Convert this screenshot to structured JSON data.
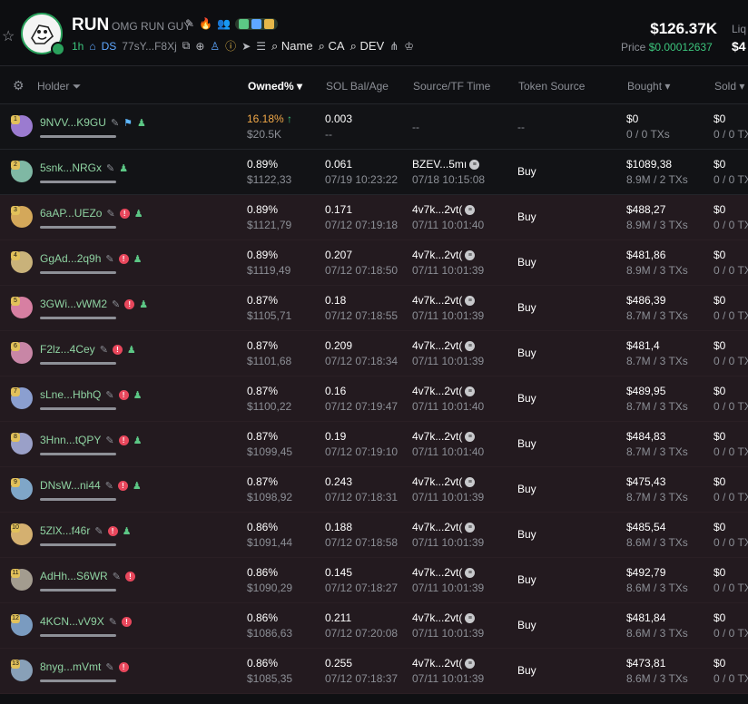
{
  "token": {
    "ticker": "RUN",
    "name": "OMG RUN GUY",
    "age": "1h",
    "ds_label": "DS",
    "ca_short": "77sY...F8Xj",
    "search_links": [
      "Name",
      "CA",
      "DEV"
    ],
    "market_cap": "$126.37K",
    "price_label": "Price",
    "price": "$0.00012637",
    "liq_label": "Liq",
    "liq_value": "$4"
  },
  "columns": {
    "holder": "Holder",
    "owned": "Owned%",
    "sol_bal": "SOL Bal/Age",
    "source": "Source/TF Time",
    "token_source": "Token Source",
    "bought": "Bought",
    "sold": "Sold"
  },
  "rows": [
    {
      "rank": "1",
      "addr": "9NVV...K9GU",
      "pct": "16.18%",
      "usd": "$20.5K",
      "sol": "0.003",
      "age": "--",
      "src": "--",
      "src_time": "",
      "tsource": "--",
      "bought": "$0",
      "bought_tx": "0 / 0 TXs",
      "sold": "$0",
      "sold_tx": "0 / 0 TX"
    },
    {
      "rank": "2",
      "addr": "5snk...NRGx",
      "pct": "0.89%",
      "usd": "$1122,33",
      "sol": "0.061",
      "age": "07/19 10:23:22",
      "src": "BZEV...5mı",
      "src_time": "07/18 10:15:08",
      "tsource": "Buy",
      "bought": "$1089,38",
      "bought_tx": "8.9M / 2 TXs",
      "sold": "$0",
      "sold_tx": "0 / 0 TX"
    },
    {
      "rank": "3",
      "addr": "6aAP...UEZo",
      "pct": "0.89%",
      "usd": "$1121,79",
      "sol": "0.171",
      "age": "07/12 07:19:18",
      "src": "4v7k...2vt(",
      "src_time": "07/11 10:01:40",
      "tsource": "Buy",
      "bought": "$488,27",
      "bought_tx": "8.9M / 3 TXs",
      "sold": "$0",
      "sold_tx": "0 / 0 TX"
    },
    {
      "rank": "4",
      "addr": "GgAd...2q9h",
      "pct": "0.89%",
      "usd": "$1119,49",
      "sol": "0.207",
      "age": "07/12 07:18:50",
      "src": "4v7k...2vt(",
      "src_time": "07/11 10:01:39",
      "tsource": "Buy",
      "bought": "$481,86",
      "bought_tx": "8.9M / 3 TXs",
      "sold": "$0",
      "sold_tx": "0 / 0 TX"
    },
    {
      "rank": "5",
      "addr": "3GWi...vWM2",
      "pct": "0.87%",
      "usd": "$1105,71",
      "sol": "0.18",
      "age": "07/12 07:18:55",
      "src": "4v7k...2vt(",
      "src_time": "07/11 10:01:39",
      "tsource": "Buy",
      "bought": "$486,39",
      "bought_tx": "8.7M / 3 TXs",
      "sold": "$0",
      "sold_tx": "0 / 0 TX"
    },
    {
      "rank": "6",
      "addr": "F2lz...4Cey",
      "pct": "0.87%",
      "usd": "$1101,68",
      "sol": "0.209",
      "age": "07/12 07:18:34",
      "src": "4v7k...2vt(",
      "src_time": "07/11 10:01:39",
      "tsource": "Buy",
      "bought": "$481,4",
      "bought_tx": "8.7M / 3 TXs",
      "sold": "$0",
      "sold_tx": "0 / 0 TX"
    },
    {
      "rank": "7",
      "addr": "sLne...HbhQ",
      "pct": "0.87%",
      "usd": "$1100,22",
      "sol": "0.16",
      "age": "07/12 07:19:47",
      "src": "4v7k...2vt(",
      "src_time": "07/11 10:01:40",
      "tsource": "Buy",
      "bought": "$489,95",
      "bought_tx": "8.7M / 3 TXs",
      "sold": "$0",
      "sold_tx": "0 / 0 TX"
    },
    {
      "rank": "8",
      "addr": "3Hnn...tQPY",
      "pct": "0.87%",
      "usd": "$1099,45",
      "sol": "0.19",
      "age": "07/12 07:19:10",
      "src": "4v7k...2vt(",
      "src_time": "07/11 10:01:40",
      "tsource": "Buy",
      "bought": "$484,83",
      "bought_tx": "8.7M / 3 TXs",
      "sold": "$0",
      "sold_tx": "0 / 0 TX"
    },
    {
      "rank": "9",
      "addr": "DNsW...ni44",
      "pct": "0.87%",
      "usd": "$1098,92",
      "sol": "0.243",
      "age": "07/12 07:18:31",
      "src": "4v7k...2vt(",
      "src_time": "07/11 10:01:39",
      "tsource": "Buy",
      "bought": "$475,43",
      "bought_tx": "8.7M / 3 TXs",
      "sold": "$0",
      "sold_tx": "0 / 0 TX"
    },
    {
      "rank": "10",
      "addr": "5ZlX...f46r",
      "pct": "0.86%",
      "usd": "$1091,44",
      "sol": "0.188",
      "age": "07/12 07:18:58",
      "src": "4v7k...2vt(",
      "src_time": "07/11 10:01:39",
      "tsource": "Buy",
      "bought": "$485,54",
      "bought_tx": "8.6M / 3 TXs",
      "sold": "$0",
      "sold_tx": "0 / 0 TX"
    },
    {
      "rank": "11",
      "addr": "AdHh...S6WR",
      "pct": "0.86%",
      "usd": "$1090,29",
      "sol": "0.145",
      "age": "07/12 07:18:27",
      "src": "4v7k...2vt(",
      "src_time": "07/11 10:01:39",
      "tsource": "Buy",
      "bought": "$492,79",
      "bought_tx": "8.6M / 3 TXs",
      "sold": "$0",
      "sold_tx": "0 / 0 TX"
    },
    {
      "rank": "12",
      "addr": "4KCN...vV9X",
      "pct": "0.86%",
      "usd": "$1086,63",
      "sol": "0.211",
      "age": "07/12 07:20:08",
      "src": "4v7k...2vt(",
      "src_time": "07/11 10:01:39",
      "tsource": "Buy",
      "bought": "$481,84",
      "bought_tx": "8.6M / 3 TXs",
      "sold": "$0",
      "sold_tx": "0 / 0 TX"
    },
    {
      "rank": "13",
      "addr": "8nyg...mVmt",
      "pct": "0.86%",
      "usd": "$1085,35",
      "sol": "0.255",
      "age": "07/12 07:18:37",
      "src": "4v7k...2vt(",
      "src_time": "07/11 10:01:39",
      "tsource": "Buy",
      "bought": "$473,81",
      "bought_tx": "8.6M / 3 TXs",
      "sold": "$0",
      "sold_tx": "0 / 0 TX"
    }
  ]
}
